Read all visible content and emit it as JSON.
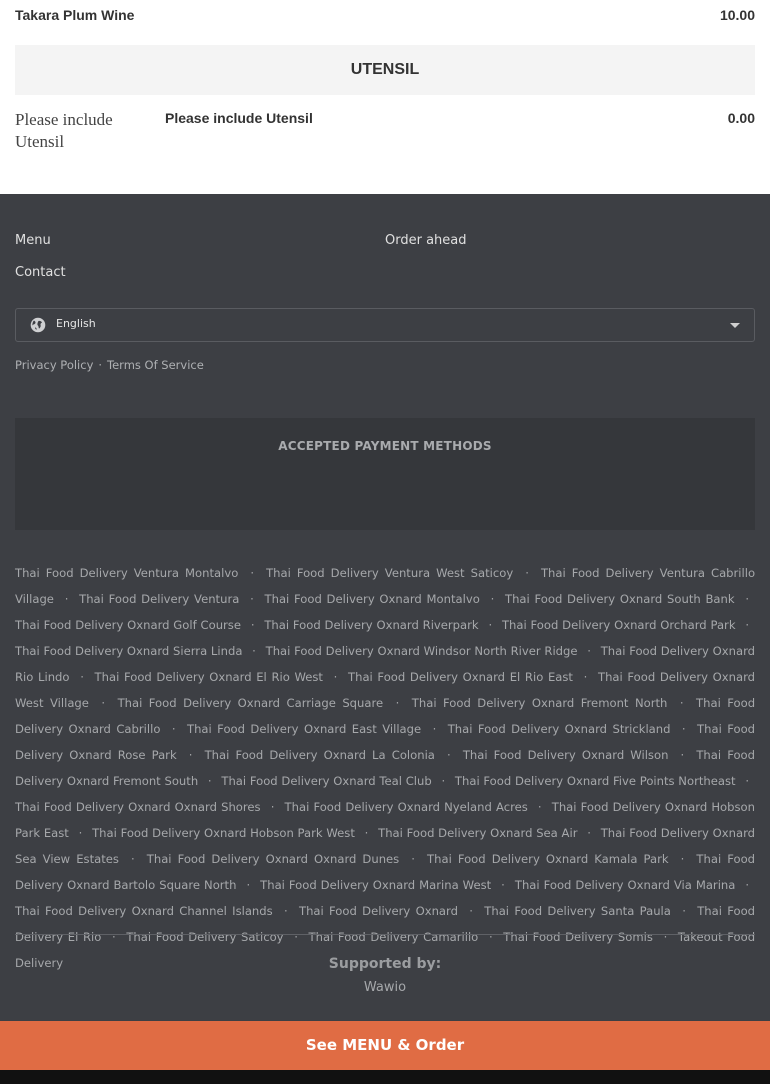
{
  "menu": {
    "item_top": {
      "name": "Takara Plum Wine",
      "price": "10.00"
    },
    "section_title": "UTENSIL",
    "utensil": {
      "image_alt": "Please include Utensil",
      "name": "Please include Utensil",
      "price": "0.00"
    }
  },
  "footer": {
    "nav": {
      "menu": "Menu",
      "order_ahead": "Order ahead",
      "contact": "Contact"
    },
    "language": {
      "selected": "English",
      "icon": "globe-icon"
    },
    "legal": {
      "privacy": "Privacy Policy",
      "separator": "·",
      "terms": "Terms Of Service"
    },
    "payment": {
      "title": "ACCEPTED PAYMENT METHODS"
    },
    "seo_links": [
      "Thai Food Delivery Ventura Montalvo",
      "Thai Food Delivery Ventura West Saticoy",
      "Thai Food Delivery Ventura Cabrillo Village",
      "Thai Food Delivery Ventura",
      "Thai Food Delivery Oxnard Montalvo",
      "Thai Food Delivery Oxnard South Bank",
      "Thai Food Delivery Oxnard Golf Course",
      "Thai Food Delivery Oxnard Riverpark",
      "Thai Food Delivery Oxnard Orchard Park",
      "Thai Food Delivery Oxnard Sierra Linda",
      "Thai Food Delivery Oxnard Windsor North River Ridge",
      "Thai Food Delivery Oxnard Rio Lindo",
      "Thai Food Delivery Oxnard El Rio West",
      "Thai Food Delivery Oxnard El Rio East",
      "Thai Food Delivery Oxnard West Village",
      "Thai Food Delivery Oxnard Carriage Square",
      "Thai Food Delivery Oxnard Fremont North",
      "Thai Food Delivery Oxnard Cabrillo",
      "Thai Food Delivery Oxnard East Village",
      "Thai Food Delivery Oxnard Strickland",
      "Thai Food Delivery Oxnard Rose Park",
      "Thai Food Delivery Oxnard La Colonia",
      "Thai Food Delivery Oxnard Wilson",
      "Thai Food Delivery Oxnard Fremont South",
      "Thai Food Delivery Oxnard Teal Club",
      "Thai Food Delivery Oxnard Five Points Northeast",
      "Thai Food Delivery Oxnard Oxnard Shores",
      "Thai Food Delivery Oxnard Nyeland Acres",
      "Thai Food Delivery Oxnard Hobson Park East",
      "Thai Food Delivery Oxnard Hobson Park West",
      "Thai Food Delivery Oxnard Sea Air",
      "Thai Food Delivery Oxnard Sea View Estates",
      "Thai Food Delivery Oxnard Oxnard Dunes",
      "Thai Food Delivery Oxnard Kamala Park",
      "Thai Food Delivery Oxnard Bartolo Square North",
      "Thai Food Delivery Oxnard Marina West",
      "Thai Food Delivery Oxnard Via Marina",
      "Thai Food Delivery Oxnard Channel Islands",
      "Thai Food Delivery Oxnard",
      "Thai Food Delivery Santa Paula",
      "Thai Food Delivery El Rio",
      "Thai Food Delivery Saticoy",
      "Thai Food Delivery Camarillo",
      "Thai Food Delivery Somis",
      "Takeout Food Delivery"
    ],
    "seo_separator": "·",
    "supported_by": "Supported by:",
    "provider": "Wawio"
  },
  "cta": {
    "label": "See MENU & Order",
    "color": "#e06c44"
  }
}
